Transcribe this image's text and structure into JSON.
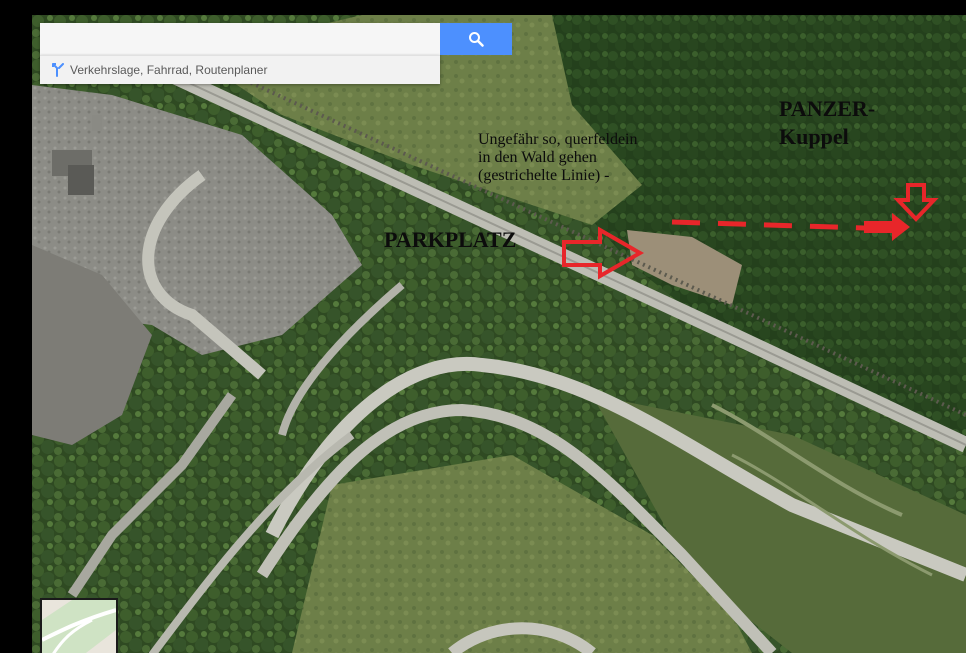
{
  "search": {
    "value": "",
    "placeholder": ""
  },
  "layers_bar": {
    "label": "Verkehrslage, Fahrrad, Routenplaner"
  },
  "annotations": {
    "parking": "PARKPLATZ",
    "panzer_line1": "PANZER-",
    "panzer_line2": "Kuppel",
    "note_line1": "Ungefähr so, querfeldein",
    "note_line2": "in den Wald gehen",
    "note_line3": "(gestrichelte Linie) -"
  },
  "icons": {
    "search": "search-icon",
    "layers": "directions-icon",
    "thumbnail": "map-view-thumbnail"
  },
  "colors": {
    "search_button": "#4d90fe",
    "arrow": "#e8262a",
    "annotation_text": "#0c0c0c"
  }
}
